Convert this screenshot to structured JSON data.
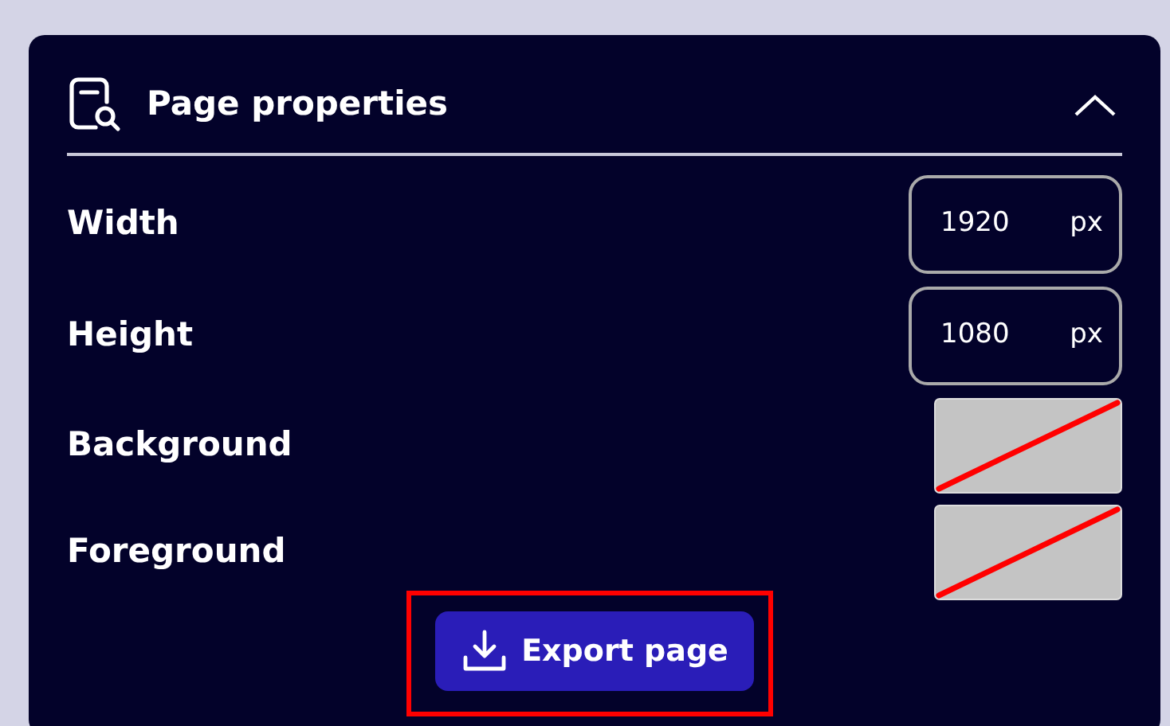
{
  "panel": {
    "title": "Page properties",
    "expanded": true,
    "fields": [
      {
        "kind": "number",
        "label": "Width",
        "value": "1920",
        "unit": "px"
      },
      {
        "kind": "number",
        "label": "Height",
        "value": "1080",
        "unit": "px"
      },
      {
        "kind": "color",
        "label": "Background"
      },
      {
        "kind": "color",
        "label": "Foreground"
      }
    ],
    "export_button": {
      "label": "Export page",
      "highlighted": true
    }
  }
}
